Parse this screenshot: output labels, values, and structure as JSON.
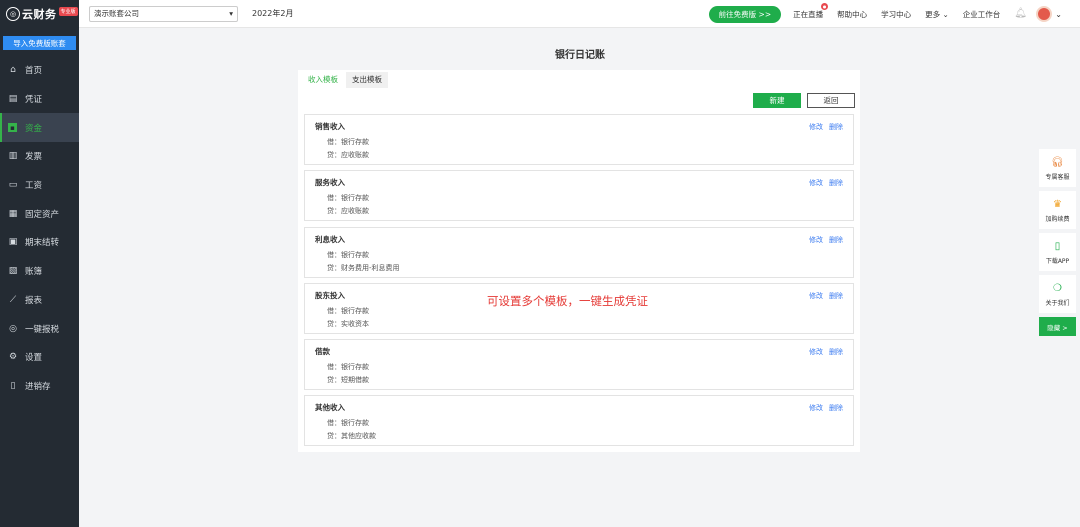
{
  "sidebar": {
    "logo_text": "云财务",
    "logo_badge": "专业版",
    "import_btn": "导入免费版账套",
    "items": [
      {
        "label": "首页",
        "icon": "home-icon",
        "glyph": "⌂"
      },
      {
        "label": "凭证",
        "icon": "voucher-icon",
        "glyph": "▤"
      },
      {
        "label": "资金",
        "icon": "fund-icon",
        "glyph": "▪",
        "active": true
      },
      {
        "label": "发票",
        "icon": "invoice-icon",
        "glyph": "▥"
      },
      {
        "label": "工资",
        "icon": "salary-icon",
        "glyph": "▭"
      },
      {
        "label": "固定资产",
        "icon": "asset-icon",
        "glyph": "▦"
      },
      {
        "label": "期末结转",
        "icon": "closing-icon",
        "glyph": "▣"
      },
      {
        "label": "账簿",
        "icon": "ledger-icon",
        "glyph": "▧"
      },
      {
        "label": "报表",
        "icon": "report-icon",
        "glyph": "⟋"
      },
      {
        "label": "一键报税",
        "icon": "tax-icon",
        "glyph": "◎"
      },
      {
        "label": "设置",
        "icon": "settings-icon",
        "glyph": "⚙"
      },
      {
        "label": "进销存",
        "icon": "inventory-icon",
        "glyph": "▯"
      }
    ]
  },
  "topbar": {
    "company": "演示账套公司",
    "period": "2022年2月",
    "upgrade": "前往免费版 >>",
    "live": "正在直播",
    "live_badge": "●",
    "help": "帮助中心",
    "learn": "学习中心",
    "more": "更多",
    "workbench": "企业工作台"
  },
  "main": {
    "title": "银行日记账",
    "tabs": [
      "收入模板",
      "支出模板"
    ],
    "new_btn": "新建",
    "back_btn": "返回",
    "edit_label": "修改",
    "delete_label": "删除",
    "templates": [
      {
        "name": "销售收入",
        "debit": "借：银行存款",
        "credit": "贷：应收账款"
      },
      {
        "name": "服务收入",
        "debit": "借：银行存款",
        "credit": "贷：应收账款"
      },
      {
        "name": "利息收入",
        "debit": "借：银行存款",
        "credit": "贷：财务费用-利息费用"
      },
      {
        "name": "股东投入",
        "debit": "借：银行存款",
        "credit": "贷：实收资本"
      },
      {
        "name": "借款",
        "debit": "借：银行存款",
        "credit": "贷：短期借款"
      },
      {
        "name": "其他收入",
        "debit": "借：银行存款",
        "credit": "贷：其他应收款"
      }
    ],
    "annotation": "可设置多个模板，一键生成凭证"
  },
  "float_panel": {
    "items": [
      {
        "label": "专属客服",
        "icon": "headset-icon"
      },
      {
        "label": "加购续费",
        "icon": "crown-icon"
      },
      {
        "label": "下载APP",
        "icon": "phone-icon"
      },
      {
        "label": "关于我们",
        "icon": "wechat-icon"
      }
    ],
    "hide": "隐藏 >"
  },
  "colors": {
    "accent": "#1fad4b",
    "sidebar": "#242b33",
    "link": "#3b7bf0",
    "annotation": "#e53935"
  }
}
